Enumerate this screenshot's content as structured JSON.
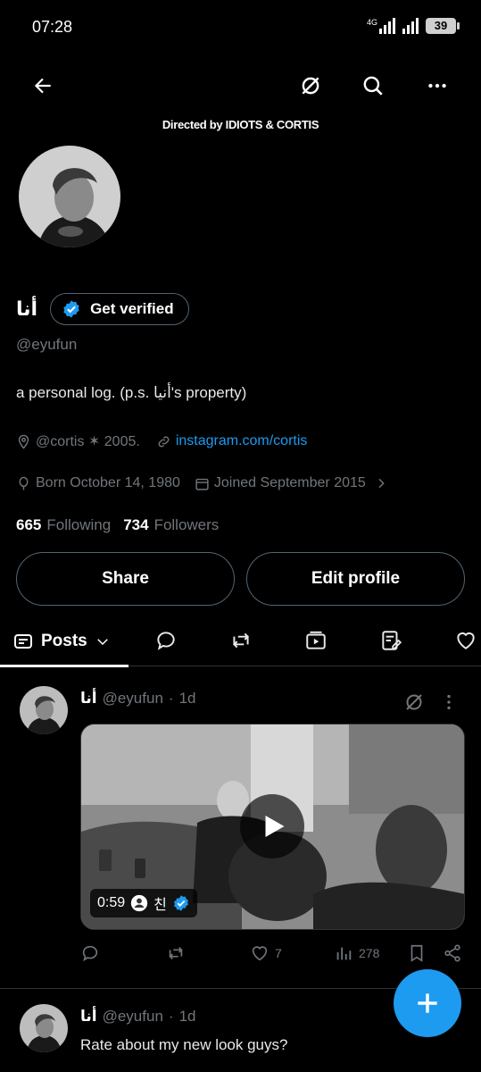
{
  "status_bar": {
    "time": "07:28",
    "network": "4G",
    "battery": "39"
  },
  "banner": {
    "text": "Directed by IDIOTS & CORTIS"
  },
  "profile": {
    "display_name": "أنا",
    "verify_label": "Get verified",
    "handle": "@eyufun",
    "bio": "a personal log. (p.s. أنيا's property)",
    "location": "@cortis ✶ 2005.",
    "link": "instagram.com/cortis",
    "born": "Born October 14, 1980",
    "joined": "Joined September 2015",
    "following_count": "665",
    "following_label": "Following",
    "followers_count": "734",
    "followers_label": "Followers"
  },
  "buttons": {
    "share": "Share",
    "edit_profile": "Edit profile"
  },
  "tabs": {
    "active": "Posts"
  },
  "posts": [
    {
      "name": "أنا",
      "handle": "@eyufun",
      "time": "1d",
      "video_duration": "0:59",
      "video_user": "친",
      "likes": "7",
      "views": "278"
    },
    {
      "name": "أنا",
      "handle": "@eyufun",
      "time": "1d",
      "text": "Rate about my new look guys?"
    }
  ],
  "colors": {
    "accent": "#1d9bf0",
    "background": "#000000",
    "muted": "#71767b"
  }
}
